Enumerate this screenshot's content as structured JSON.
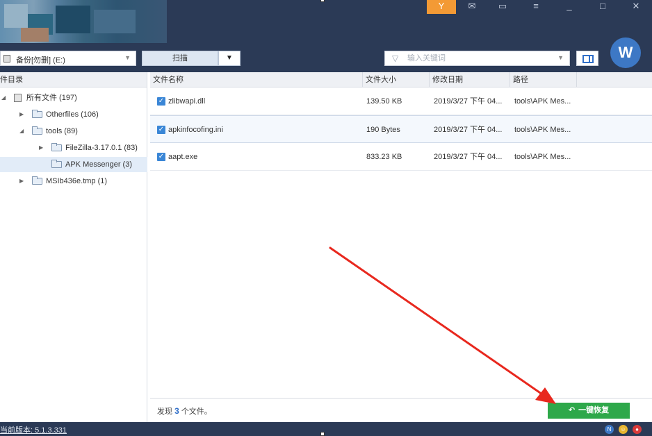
{
  "window": {
    "controls": {
      "skin_icon": "Y",
      "mail_icon": "✉",
      "feedback_icon": "▭",
      "menu_icon": "≡",
      "minimize": "_",
      "maximize": "□",
      "close": "✕"
    }
  },
  "toolbar": {
    "drive_label": "备份[勿删] (E:)",
    "scan_label": "扫描",
    "search_placeholder": "输入关键词",
    "avatar_letter": "W"
  },
  "tree": {
    "header": "件目录",
    "nodes": [
      {
        "label": "所有文件 (197)"
      },
      {
        "label": "Otherfiles (106)"
      },
      {
        "label": "tools (89)"
      },
      {
        "label": "FileZilla-3.17.0.1 (83)"
      },
      {
        "label": "APK Messenger (3)"
      },
      {
        "label": "MSIb436e.tmp (1)"
      }
    ]
  },
  "list": {
    "columns": [
      "文件名称",
      "文件大小",
      "修改日期",
      "路径"
    ],
    "rows": [
      {
        "name": "zlibwapi.dll",
        "size": "139.50 KB",
        "date": "2019/3/27 下午 04...",
        "path": "tools\\APK Mes..."
      },
      {
        "name": "apkinfocofing.ini",
        "size": "190 Bytes",
        "date": "2019/3/27 下午 04...",
        "path": "tools\\APK Mes..."
      },
      {
        "name": "aapt.exe",
        "size": "833.23 KB",
        "date": "2019/3/27 下午 04...",
        "path": "tools\\APK Mes..."
      }
    ]
  },
  "status": {
    "prefix": "发现",
    "count": "3",
    "suffix": "个文件。",
    "recover_label": "一键恢复"
  },
  "footer": {
    "version": "当前版本: 5.1.3.331"
  },
  "colors": {
    "chrome": "#2b3a56",
    "accent_orange": "#f39a35",
    "recover_green": "#2ea84a",
    "arrow_red": "#e8281e",
    "check_blue": "#3a86d6"
  }
}
